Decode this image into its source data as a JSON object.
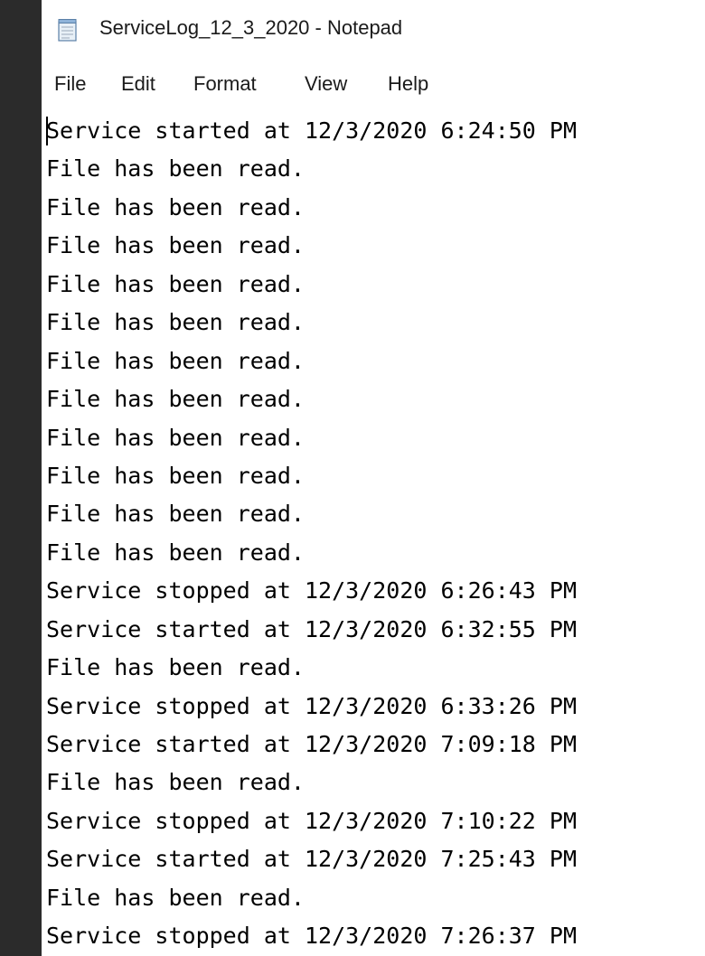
{
  "window": {
    "title": "ServiceLog_12_3_2020 - Notepad",
    "app_icon": "notepad-icon"
  },
  "menu": {
    "items": [
      "File",
      "Edit",
      "Format",
      "View",
      "Help"
    ]
  },
  "editor": {
    "lines": [
      "Service started at 12/3/2020 6:24:50 PM",
      "File has been read.",
      "File has been read.",
      "File has been read.",
      "File has been read.",
      "File has been read.",
      "File has been read.",
      "File has been read.",
      "File has been read.",
      "File has been read.",
      "File has been read.",
      "File has been read.",
      "Service stopped at 12/3/2020 6:26:43 PM",
      "Service started at 12/3/2020 6:32:55 PM",
      "File has been read.",
      "Service stopped at 12/3/2020 6:33:26 PM",
      "Service started at 12/3/2020 7:09:18 PM",
      "File has been read.",
      "Service stopped at 12/3/2020 7:10:22 PM",
      "Service started at 12/3/2020 7:25:43 PM",
      "File has been read.",
      "Service stopped at 12/3/2020 7:26:37 PM"
    ]
  }
}
